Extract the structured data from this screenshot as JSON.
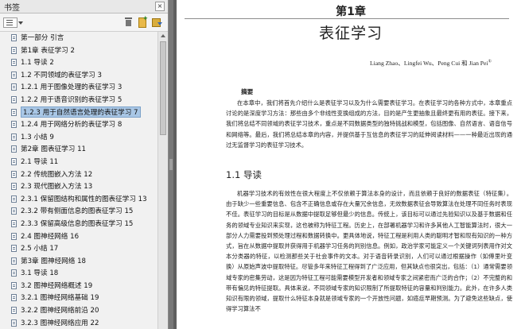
{
  "panel": {
    "title": "书签",
    "close": "×",
    "tools": {
      "options": "options-menu",
      "delete": "delete-bookmark",
      "new": "new-bookmark",
      "expand": "expand-bookmark"
    },
    "selected_index": 6,
    "bookmarks": [
      "第一部分 引言",
      "第1章 表征学习 2",
      "1.1 导读 2",
      "1.2 不同领域的表征学习 3",
      "1.2.1 用于图像处理的表征学习 3",
      "1.2.2 用于语音识别的表征学习 5",
      "1.2.3 用于自然语言处理的表征学习 7",
      "1.2.4 用于网络分析的表征学习 8",
      "1.3 小结 9",
      "第2章 图表征学习 11",
      "2.1 导读 11",
      "2.2 传统图嵌入方法 12",
      "2.3 现代图嵌入方法 13",
      "2.3.1 保留图结构和属性的图表征学习 13",
      "2.3.2 带有侧面信息的图表征学习 15",
      "2.3.3 保留高级信息的图表征学习 15",
      "2.4 图神经网络 16",
      "2.5 小结 17",
      "第3章 图神经网络 18",
      "3.1 导读 18",
      "3.2 图神经网络概述 19",
      "3.2.1 图神经网络基础 19",
      "3.2.2 图神经网络前沿 20",
      "3.2.3 图神经网络应用 22",
      "3.2.4 本书组织结构 23"
    ]
  },
  "document": {
    "chapter_number": "第1章",
    "chapter_title": "表征学习",
    "authors": "Liang Zhao、Lingfei Wu、Peng Cui 和 Jian Pei",
    "footnote_mark": "①",
    "abstract_heading": "摘要",
    "abstract_text": "在本章中，我们将首先介绍什么是表征学习以及为什么需要表征学习。在表征学习的各种方式中，本章重点讨论的是深度学习方法：那些由多个非线性变换组成的方法，目的是产生更抽象且最终更有用的表征。接下来，我们将总结不同领域的表征学习技术，重点是不同数据类型的独特挑战和模型，包括图像、自然语言、语音信号和网络等。最后，我们将总结本章的内容，并提供基于互信息的表征学习的延伸阅读材料——一种最近出现的通过无监督学习的表征学习技术。",
    "section_heading": "1.1   导读",
    "body_text": "机器学习技术的有效性在很大程度上不仅依赖于算法本身的设计，而且依赖于良好的数据表征（特征集）。由于缺少一些重要信息、包含不正确信息或存在大量冗余信息，无效数据表征会导致算法在处理不同任务时表现不佳。表征学习的目标是从数据中提取足够但最少的信息。传统上，该目标可以通过先验知识以及基于数据和任务的领域专业知识来实现，这也被称为特征工程。历史上，在部署机器学习和许多其他人工智能算法时，很大一部分人力需要投到预处理过程和数据转换中。更具体地说，特征工程是利用人类的聪明才智和现有知识的一种方式，旨在从数据中提取并获得用于机器学习任务的判别信息。例如，政治学家可能定义一个关键词列表用作对文本分类器的特征，以检测那些关于社会事件的文本。对于语音转录识别，人们可以通过根据操作（如傅里叶变换）从原始声波中提取特征。尽管多年来特征工程得到了广泛应用，但其缺点也很突出，包括：（1）通常需要领域专家的密集劳动，这是因为特征工程可能需要模型开发者和领域专家之间紧密而广泛的合作；（2）不完整的和带有偏见的特征提取。具体来说，不同领域专家的知识限制了所提取特征的容量和判别能力。此外，在许多人类知识有限的领域，提取什么特征本身就是领域专家的一个开放性问题，如癌症早期预测。为了避免这些缺点，使得学习算法不"
  }
}
